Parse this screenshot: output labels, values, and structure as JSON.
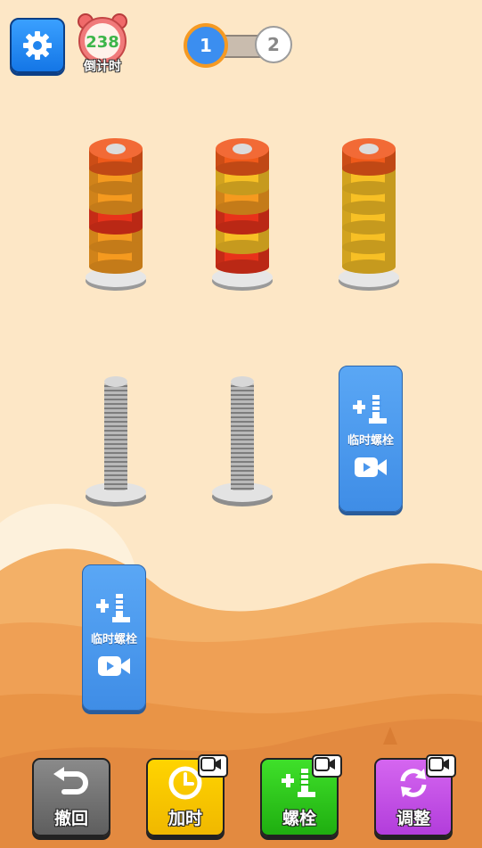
{
  "header": {
    "settings_icon": "gear-icon",
    "timer": {
      "value": "238",
      "label": "倒计时",
      "icon": "alarm-clock-icon"
    },
    "levels": {
      "current": "1",
      "next": "2"
    }
  },
  "board": {
    "stacks": [
      {
        "nut_colors": [
          "#f05a1a",
          "#f59a1f",
          "#f59a1f",
          "#e8321a",
          "#f59a1f",
          "#f59a1f"
        ]
      },
      {
        "nut_colors": [
          "#f05a1a",
          "#f7c025",
          "#f59a1f",
          "#e8321a",
          "#f7c025",
          "#e8321a"
        ]
      },
      {
        "nut_colors": [
          "#f05a1a",
          "#f7c025",
          "#f7c025",
          "#f7c025",
          "#f7c025",
          "#f7c025"
        ]
      }
    ],
    "temp_bolt_label": "临时螺栓",
    "temp_bolt_icon": "plus-bolt-icon",
    "video_icon": "video-camera-icon"
  },
  "toolbar": {
    "undo": {
      "label": "撤回",
      "icon": "undo-arrow-icon",
      "color": "#6a6a6a"
    },
    "add_time": {
      "label": "加时",
      "icon": "clock-icon",
      "color": "#f7c600"
    },
    "bolt": {
      "label": "螺栓",
      "icon": "plus-bolt-icon",
      "color": "#2fc51b"
    },
    "shuffle": {
      "label": "调整",
      "icon": "refresh-icon",
      "color": "#c44ae6"
    }
  }
}
